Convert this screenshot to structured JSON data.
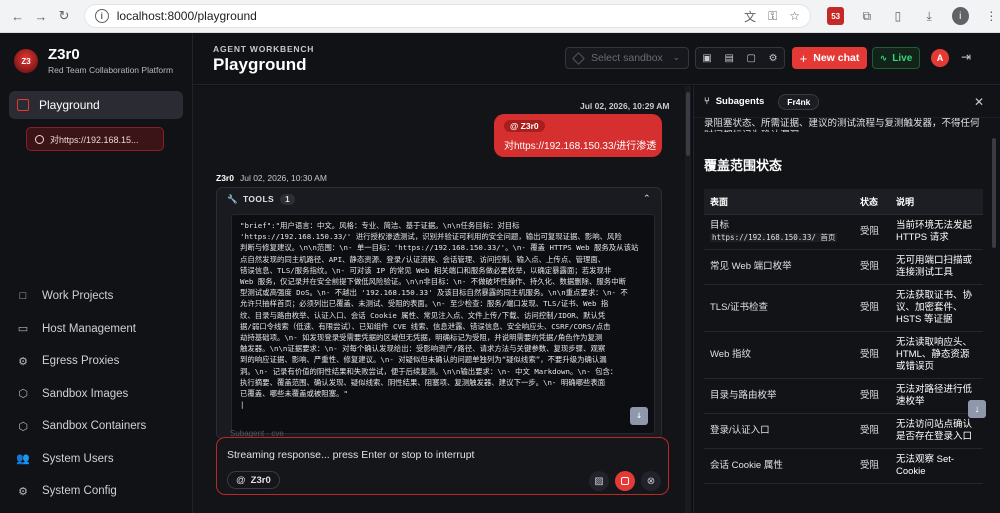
{
  "browser": {
    "url": "localhost:8000/playground",
    "nav_back": "←",
    "nav_forward": "→",
    "nav_reload": "↻",
    "avatar_letter": "i",
    "ext_badge": "53"
  },
  "sidebar": {
    "brand_title": "Z3r0",
    "brand_subtitle": "Red Team Collaboration Platform",
    "logo_text": "Z3",
    "active_item": "Playground",
    "chat_item": "对https://192.168.15...",
    "items": [
      {
        "label": "Work Projects",
        "icon": "□"
      },
      {
        "label": "Host Management",
        "icon": "▭"
      },
      {
        "label": "Egress Proxies",
        "icon": "⚙"
      },
      {
        "label": "Sandbox Images",
        "icon": "⬡"
      },
      {
        "label": "Sandbox Containers",
        "icon": "⬡"
      },
      {
        "label": "System Users",
        "icon": "👥"
      },
      {
        "label": "System Config",
        "icon": "⚙"
      }
    ]
  },
  "header": {
    "eyebrow": "AGENT WORKBENCH",
    "title": "Playground",
    "sandbox_placeholder": "Select sandbox",
    "new_chat": "New chat",
    "live": "Live",
    "user_initial": "A"
  },
  "chat": {
    "user_time": "Jul 02, 2026, 10:29 AM",
    "user_tag": "@ Z3r0",
    "user_text": "对https://192.168.150.33/进行渗透",
    "agent_name": "Z3r0",
    "agent_time": "Jul 02, 2026, 10:30 AM",
    "tools_label": "TOOLS",
    "tools_count": "1",
    "code_lines": [
      "  \"brief\":\"用户语言：中文。风格：专业、简洁、基于证据。\\n\\n任务目标：对目标",
      "'https://192.168.150.33/' 进行授权渗透测试，识别并验证可利用的安全问题，输出可复现证据、影响、风险",
      "判断与修复建议。\\n\\n范围：\\n- 单一目标：'https://192.168.150.33/'。\\n- 覆盖 HTTPS Web 服务及从该站",
      "点自然发现的同主机路径、API、静态资源、登录/认证流程、会话管理、访问控制、输入点、上传点、管理面、",
      "错误信息、TLS/服务指纹。\\n- 可对该 IP 的常见 Web 相关端口和服务做必要枚举，以确定暴露面；若发现非",
      "Web 服务，仅记录并在安全前提下做低风险验证。\\n\\n非目标：\\n- 不做破坏性操作、持久化、数据删除、服务中断",
      "型测试或高强度 DoS。\\n- 不越出 '192.168.150.33' 及该目标自然暴露的同主机服务。\\n\\n重点要求：\\n- 不",
      "允许只抽样首页；必须列出已覆盖、未测试、受阻的表面。\\n- 至少检查：服务/端口发现、TLS/证书、Web 指",
      "纹、目录与路由枚举、认证入口、会话 Cookie 属性、常见注入点、文件上传/下载、访问控制/IDOR、默认凭",
      "据/弱口令线索（低速、有限尝试）、已知组件 CVE 线索、信息泄露、错误信息、安全响应头、CSRF/CORS/点击",
      "劫持基础项。\\n- 如发现登录受需要凭据的区域但无凭据，明确标记为受阻，并说明需要的凭据/角色作为复测",
      "触发器。\\n\\n证据要求：\\n- 对每个确认发现给出：受影响资产/路径、请求方法与关键参数、复现步骤、观察",
      "到的响应证据、影响、严重性、修复建议。\\n- 对疑似但未确认的问题单独列为“疑似线索”，不要升级为确认漏",
      "洞。\\n- 记录有价值的阴性结果和失败尝试，便于后续复测。\\n\\n输出要求：\\n- 中文 Markdown。\\n- 包含：",
      "执行摘要、覆盖范围、确认发现、疑似线索、阴性结果、阻塞项、复测触发器、建议下一步。\\n- 明确哪些表面",
      "已覆盖、哪些未覆盖或被阻塞。\"",
      "|"
    ],
    "ghost_text": "Subagent · cve",
    "composer_placeholder": "Streaming response... press Enter or stop to interrupt",
    "composer_agent": "Z3r0"
  },
  "panel": {
    "title": "Subagents",
    "agent_tab": "Fr4nk",
    "intro": "录阻塞状态、所需证据、建议的测试流程与复测触发器，不得任何时间都标记为确认漏洞。",
    "section_title": "覆盖范围状态",
    "columns": [
      "表面",
      "状态",
      "说明"
    ],
    "rows": [
      {
        "surface": "目标",
        "mono": "https://192.168.150.33/ 首页",
        "state": "受阻",
        "note": "当前环境无法发起 HTTPS 请求"
      },
      {
        "surface": "常见 Web 端口枚举",
        "mono": "",
        "state": "受阻",
        "note": "无可用端口扫描或连接测试工具"
      },
      {
        "surface": "TLS/证书检查",
        "mono": "",
        "state": "受阻",
        "note": "无法获取证书、协议、加密套件、HSTS 等证据"
      },
      {
        "surface": "Web 指纹",
        "mono": "",
        "state": "受阻",
        "note": "无法读取响应头、HTML、静态资源或错误页"
      },
      {
        "surface": "目录与路由枚举",
        "mono": "",
        "state": "受阻",
        "note": "无法对路径进行低速枚举"
      },
      {
        "surface": "登录/认证入口",
        "mono": "",
        "state": "受阻",
        "note": "无法访问站点确认是否存在登录入口"
      },
      {
        "surface": "会话 Cookie 属性",
        "mono": "",
        "state": "受阻",
        "note": "无法观察 Set-Cookie"
      }
    ]
  }
}
